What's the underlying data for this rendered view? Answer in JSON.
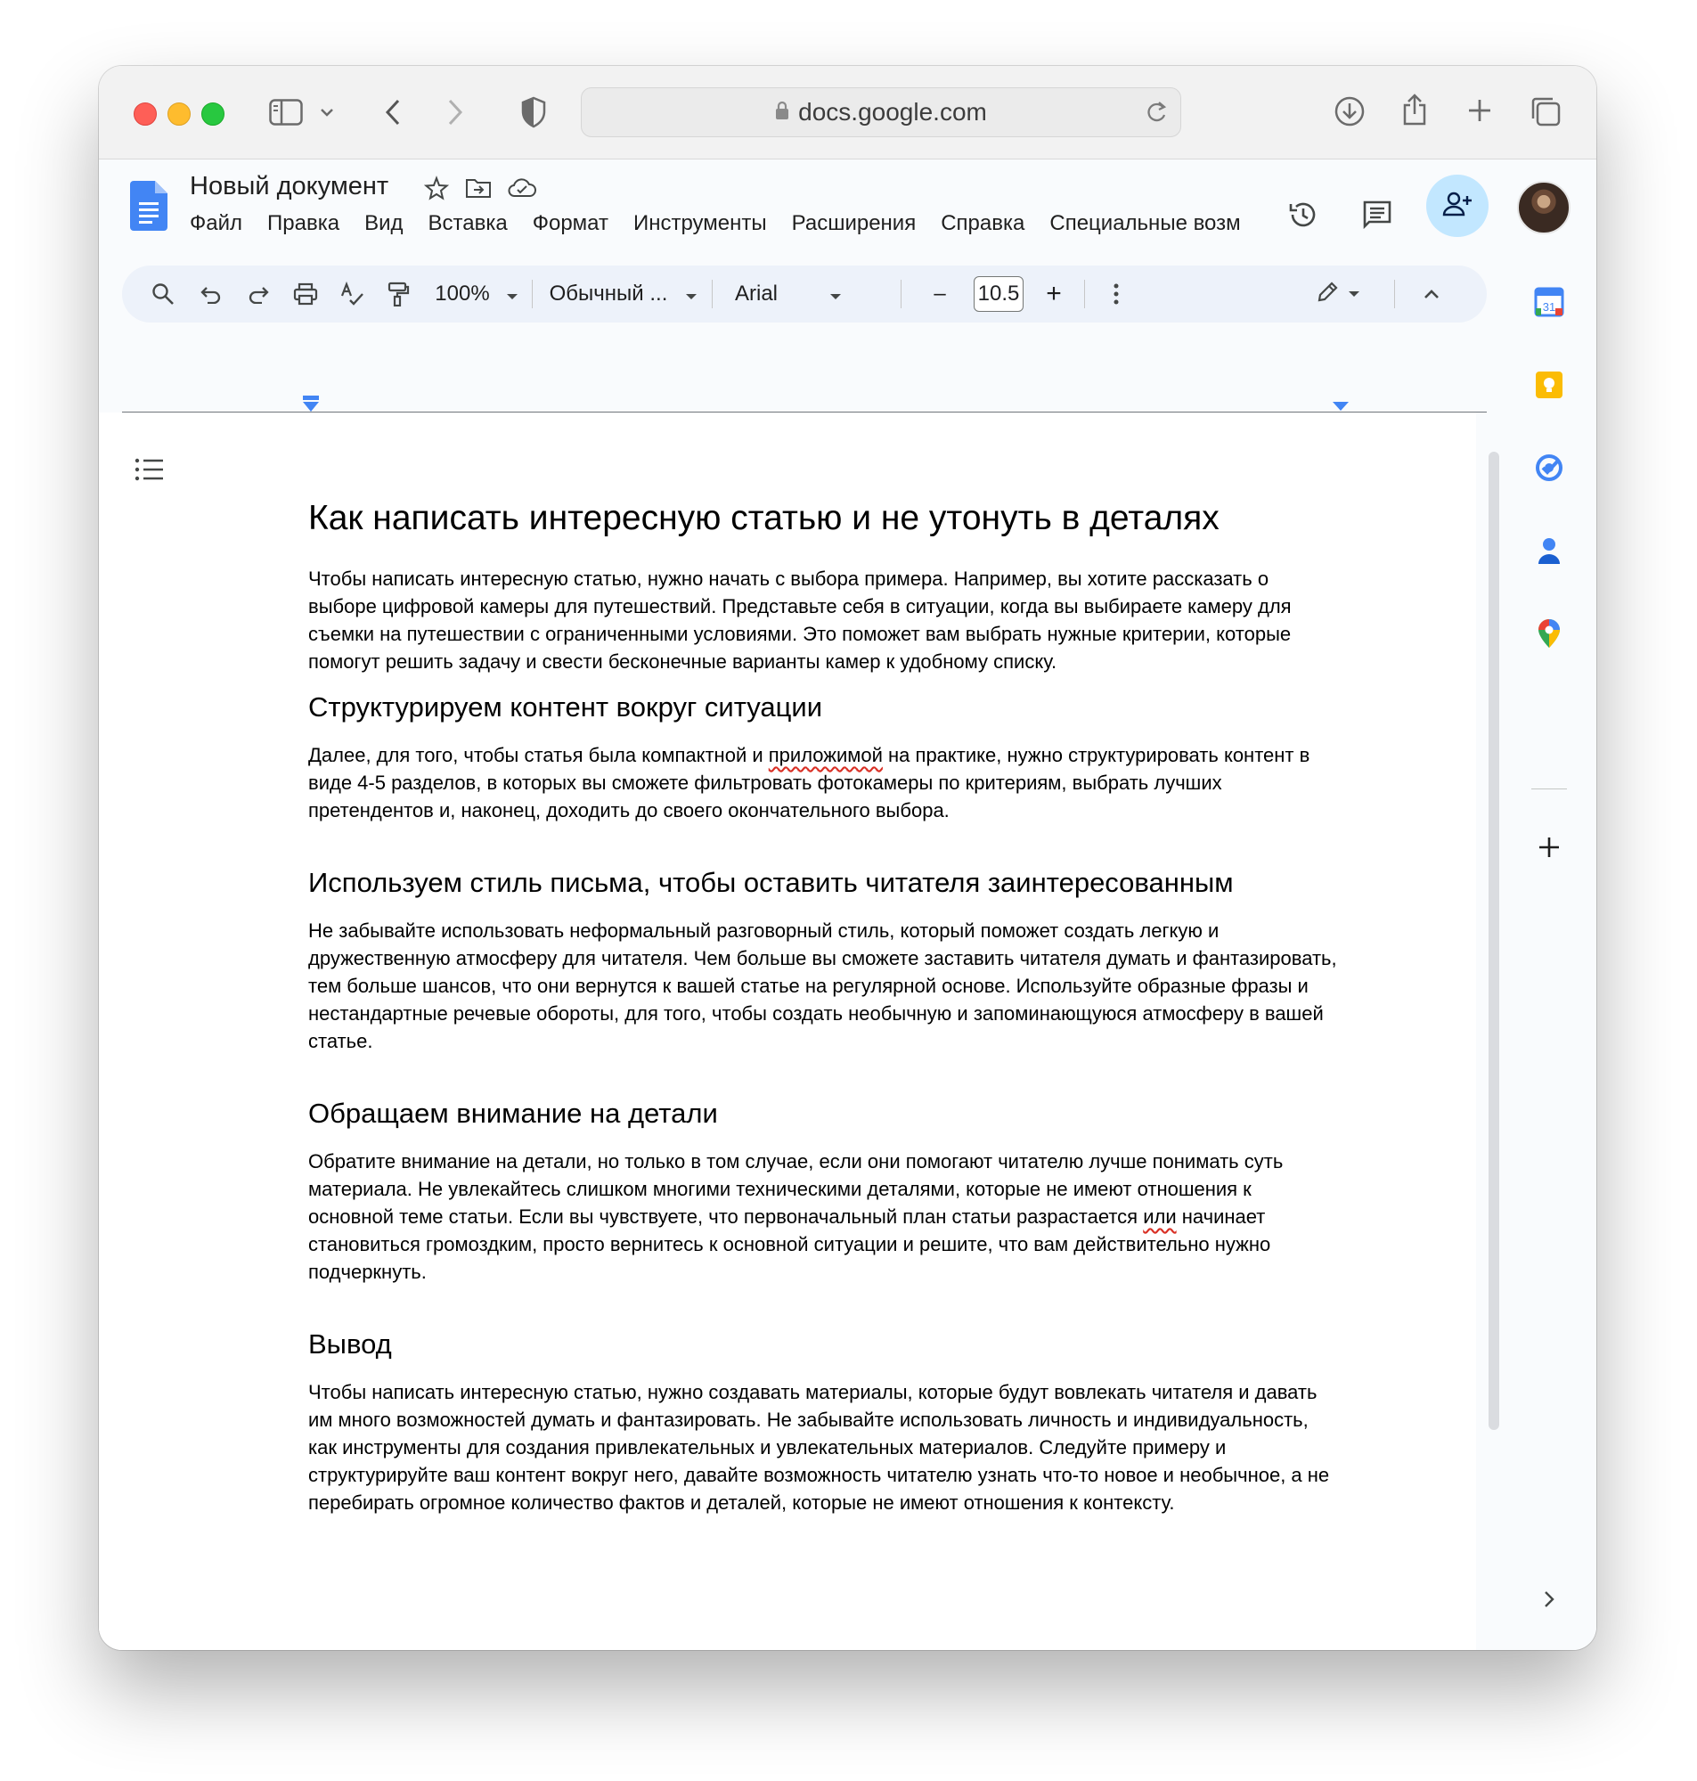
{
  "browser": {
    "url": "docs.google.com"
  },
  "doc": {
    "title": "Новый документ",
    "menu": [
      "Файл",
      "Правка",
      "Вид",
      "Вставка",
      "Формат",
      "Инструменты",
      "Расширения",
      "Справка",
      "Специальные возм"
    ]
  },
  "toolbar": {
    "zoom": "100%",
    "style": "Обычный ...",
    "font": "Arial",
    "font_size": "10.5",
    "minus": "–",
    "plus": "+"
  },
  "content": {
    "title": "Как написать интересную статью и не утонуть в деталях",
    "p1": "Чтобы написать интересную статью, нужно начать с выбора примера. Например, вы хотите рассказать о выборе цифровой камеры для путешествий. Представьте себя в ситуации, когда вы выбираете камеру для съемки на путешествии с ограниченными условиями. Это поможет вам выбрать нужные критерии, которые помогут решить задачу и свести бесконечные варианты камер к удобному списку.",
    "h2_1": "Структурируем контент вокруг ситуации",
    "p2_before": "Далее, для того, чтобы статья была компактной и ",
    "p2_misspelled": "приложимой",
    "p2_after": " на практике, нужно структурировать контент в виде 4-5 разделов, в которых вы сможете фильтровать фотокамеры по критериям, выбрать лучших претендентов и, наконец, доходить до своего окончательного выбора.",
    "h2_2": "Используем стиль письма, чтобы оставить читателя заинтересованным",
    "p3": "Не забывайте использовать неформальный разговорный стиль, который поможет создать легкую и дружественную атмосферу для читателя. Чем больше вы сможете заставить читателя думать и фантазировать, тем больше шансов, что они вернутся к вашей статье на регулярной основе. Используйте образные фразы и нестандартные речевые обороты, для того, чтобы создать необычную и запоминающуюся атмосферу в вашей статье.",
    "h2_3": "Обращаем внимание на детали",
    "p4_before": "Обратите внимание на детали, но только в том случае, если они помогают читателю лучше понимать суть материала. Не увлекайтесь слишком многими техническими деталями, которые не имеют отношения к основной теме статьи. Если вы чувствуете, что первоначальный план статьи разрастается ",
    "p4_misspelled": "или",
    "p4_after": " начинает становиться громоздким, просто вернитесь к основной ситуации и решите, что вам действительно нужно подчеркнуть.",
    "h2_4": "Вывод",
    "p5": "Чтобы написать интересную статью, нужно создавать материалы, которые будут вовлекать читателя и давать им много возможностей думать и фантазировать. Не забывайте использовать личность и индивидуальность, как инструменты для создания привлекательных и увлекательных материалов. Следуйте примеру и структурируйте ваш контент вокруг него, давайте возможность читателю узнать что-то новое и необычное, а не перебирать огромное количество фактов и деталей, которые не имеют отношения к контексту."
  },
  "sidepanel": {
    "calendar_day": "31"
  },
  "colors": {
    "docs_blue": "#4285f4",
    "share_bg": "#c2e7ff",
    "toolbar_bg": "#edf2fa",
    "spell_error": "#d93025"
  },
  "icons": [
    "sidebar-icon",
    "chevron-down-icon",
    "back-icon",
    "forward-icon",
    "shield-icon",
    "lock-icon",
    "reload-icon",
    "download-icon",
    "share-icon",
    "new-tab-icon",
    "tabs-icon",
    "star-icon",
    "move-folder-icon",
    "cloud-icon",
    "history-icon",
    "comment-icon",
    "add-person-icon",
    "search-icon",
    "undo-icon",
    "redo-icon",
    "print-icon",
    "spellcheck-icon",
    "paint-format-icon",
    "more-vert-icon",
    "pencil-icon",
    "chevron-up-icon",
    "outline-icon",
    "calendar-icon",
    "keep-icon",
    "tasks-icon",
    "contacts-icon",
    "maps-icon",
    "plus-icon",
    "chevron-right-icon"
  ]
}
